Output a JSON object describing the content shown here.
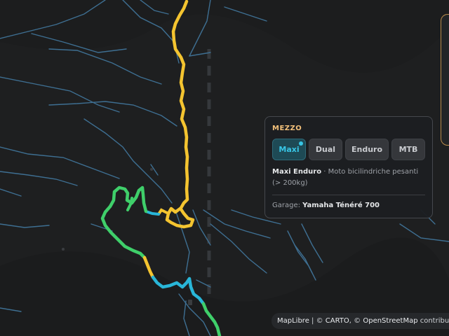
{
  "panel": {
    "title": "MEZZO",
    "modes": [
      {
        "label": "Maxi",
        "active": true
      },
      {
        "label": "Dual",
        "active": false
      },
      {
        "label": "Enduro",
        "active": false
      },
      {
        "label": "MTB",
        "active": false
      }
    ],
    "description_name": "Maxi Enduro",
    "description_text": " · Moto bicilindriche pesanti (> 200kg)",
    "garage_label": "Garage: ",
    "garage_value": "Yamaha Ténéré 700"
  },
  "attribution": {
    "maplibre": "MapLibre",
    "sep1": " | © ",
    "carto": "CARTO",
    "sep2": ", © ",
    "osm": "OpenStreetMap",
    "contributors": " contributors"
  },
  "colors": {
    "map_bg": "#1e1f20",
    "rivers": "#3e6f92",
    "route_yellow": "#f4c430",
    "route_green": "#3fcf6a",
    "route_cyan": "#29b6d8",
    "accent": "#38c6e6",
    "title_accent": "#f2c07a"
  }
}
